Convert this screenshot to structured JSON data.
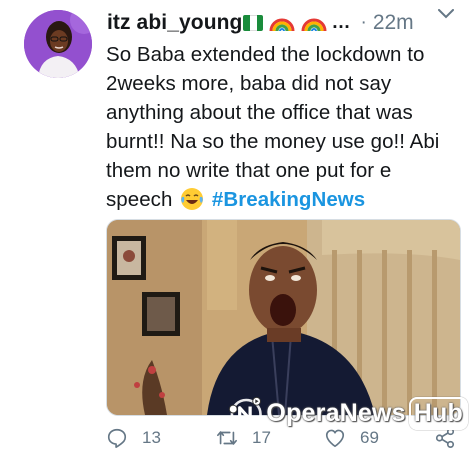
{
  "tweet": {
    "display_name": "itz abi_young",
    "ellipsis": "…",
    "separator": "·",
    "time": "22m",
    "text_lines": [
      "So Baba extended the lockdown to",
      "2weeks more, baba did not say",
      "anything about the office that was",
      "burnt!! Na so the money use go!! Abi",
      "them no write that one put for e"
    ],
    "last_line_text": "speech",
    "hashtag": "#BreakingNews",
    "emoji_name": "face-with-tears-of-joy",
    "flag_colors": [
      "#1a8c3c",
      "#ffffff",
      "#1a8c3c"
    ],
    "accent_color": "#1b95e0"
  },
  "actions": {
    "reply_count": "13",
    "retweet_count": "17",
    "like_count": "69"
  },
  "watermark": {
    "brand": "OperaNews",
    "suffix": "Hub"
  }
}
